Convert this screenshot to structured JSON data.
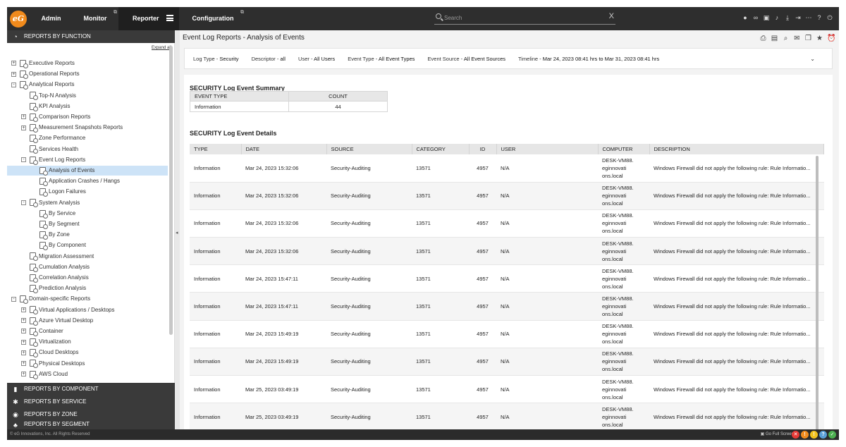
{
  "topbar": {
    "logo": "eG",
    "tabs": [
      {
        "label": "Admin"
      },
      {
        "label": "Monitor"
      },
      {
        "label": "Reporter"
      },
      {
        "label": "Configuration"
      }
    ],
    "search_placeholder": "Search",
    "clear": "X",
    "icons": [
      "user-icon",
      "link-icon",
      "image-icon",
      "bell-icon",
      "download-icon",
      "logout-icon",
      "more-icon",
      "help-icon",
      "power-icon"
    ]
  },
  "sidebar": {
    "sections": {
      "function": "REPORTS BY FUNCTION",
      "component": "REPORTS BY COMPONENT",
      "service": "REPORTS BY SERVICE",
      "zone": "REPORTS BY ZONE",
      "segment": "REPORTS BY SEGMENT"
    },
    "expand_all": "Expand all",
    "tree": [
      {
        "label": "Executive Reports",
        "level": 0,
        "toggle": "+"
      },
      {
        "label": "Operational Reports",
        "level": 0,
        "toggle": "+"
      },
      {
        "label": "Analytical Reports",
        "level": 0,
        "toggle": "-"
      },
      {
        "label": "Top-N Analysis",
        "level": 1,
        "toggle": ""
      },
      {
        "label": "KPI Analysis",
        "level": 1,
        "toggle": ""
      },
      {
        "label": "Comparison Reports",
        "level": 1,
        "toggle": "+"
      },
      {
        "label": "Measurement Snapshots Reports",
        "level": 1,
        "toggle": "+"
      },
      {
        "label": "Zone Performance",
        "level": 1,
        "toggle": ""
      },
      {
        "label": "Services Health",
        "level": 1,
        "toggle": ""
      },
      {
        "label": "Event Log Reports",
        "level": 1,
        "toggle": "-"
      },
      {
        "label": "Analysis of Events",
        "level": 2,
        "toggle": "",
        "selected": true
      },
      {
        "label": "Application Crashes / Hangs",
        "level": 2,
        "toggle": ""
      },
      {
        "label": "Logon Failures",
        "level": 2,
        "toggle": ""
      },
      {
        "label": "System Analysis",
        "level": 1,
        "toggle": "-"
      },
      {
        "label": "By Service",
        "level": 2,
        "toggle": ""
      },
      {
        "label": "By Segment",
        "level": 2,
        "toggle": ""
      },
      {
        "label": "By Zone",
        "level": 2,
        "toggle": ""
      },
      {
        "label": "By Component",
        "level": 2,
        "toggle": ""
      },
      {
        "label": "Migration Assessment",
        "level": 1,
        "toggle": ""
      },
      {
        "label": "Cumulation Analysis",
        "level": 1,
        "toggle": ""
      },
      {
        "label": "Correlation Analysis",
        "level": 1,
        "toggle": ""
      },
      {
        "label": "Prediction Analysis",
        "level": 1,
        "toggle": ""
      },
      {
        "label": "Domain-specific Reports",
        "level": 0,
        "toggle": "-"
      },
      {
        "label": "Virtual Applications / Desktops",
        "level": 1,
        "toggle": "+"
      },
      {
        "label": "Azure Virtual Desktop",
        "level": 1,
        "toggle": "+"
      },
      {
        "label": "Container",
        "level": 1,
        "toggle": "+"
      },
      {
        "label": "Virtualization",
        "level": 1,
        "toggle": "+"
      },
      {
        "label": "Cloud Desktops",
        "level": 1,
        "toggle": "+"
      },
      {
        "label": "Physical Desktops",
        "level": 1,
        "toggle": "+"
      },
      {
        "label": "AWS Cloud",
        "level": 1,
        "toggle": "+"
      }
    ]
  },
  "main": {
    "title": "Event Log Reports - Analysis of Events",
    "filters": [
      {
        "key": "Log Type - ",
        "value": "Security"
      },
      {
        "key": "Descriptor - ",
        "value": "all"
      },
      {
        "key": "User - ",
        "value": "All Users"
      },
      {
        "key": "Event Type - ",
        "value": "All Event Types"
      },
      {
        "key": "Event Source - ",
        "value": "All Event Sources"
      },
      {
        "key": "Timeline - ",
        "value": "Mar 24, 2023 08:41 hrs to Mar 31, 2023 08:41 hrs"
      }
    ],
    "summary_title": "SECURITY Log Event Summary",
    "summary_headers": [
      "EVENT TYPE",
      "COUNT"
    ],
    "summary_rows": [
      [
        "Information",
        "44"
      ]
    ],
    "details_title": "SECURITY Log Event Details",
    "details_headers": [
      "TYPE",
      "DATE",
      "SOURCE",
      "CATEGORY",
      "ID",
      "USER",
      "COMPUTER",
      "DESCRIPTION"
    ],
    "details_rows": [
      [
        "Information",
        "Mar 24, 2023 15:32:06",
        "Security-Auditing",
        "13571",
        "4957",
        "N/A",
        "DESK-VM88.|eginnovati|ons.local",
        "Windows Firewall did not apply the following rule: Rule Informatio..."
      ],
      [
        "Information",
        "Mar 24, 2023 15:32:06",
        "Security-Auditing",
        "13571",
        "4957",
        "N/A",
        "DESK-VM88.|eginnovati|ons.local",
        "Windows Firewall did not apply the following rule: Rule Informatio..."
      ],
      [
        "Information",
        "Mar 24, 2023 15:32:06",
        "Security-Auditing",
        "13571",
        "4957",
        "N/A",
        "DESK-VM88.|eginnovati|ons.local",
        "Windows Firewall did not apply the following rule: Rule Informatio..."
      ],
      [
        "Information",
        "Mar 24, 2023 15:32:06",
        "Security-Auditing",
        "13571",
        "4957",
        "N/A",
        "DESK-VM88.|eginnovati|ons.local",
        "Windows Firewall did not apply the following rule: Rule Informatio..."
      ],
      [
        "Information",
        "Mar 24, 2023 15:47:11",
        "Security-Auditing",
        "13571",
        "4957",
        "N/A",
        "DESK-VM88.|eginnovati|ons.local",
        "Windows Firewall did not apply the following rule: Rule Informatio..."
      ],
      [
        "Information",
        "Mar 24, 2023 15:47:11",
        "Security-Auditing",
        "13571",
        "4957",
        "N/A",
        "DESK-VM88.|eginnovati|ons.local",
        "Windows Firewall did not apply the following rule: Rule Informatio..."
      ],
      [
        "Information",
        "Mar 24, 2023 15:49:19",
        "Security-Auditing",
        "13571",
        "4957",
        "N/A",
        "DESK-VM88.|eginnovati|ons.local",
        "Windows Firewall did not apply the following rule: Rule Informatio..."
      ],
      [
        "Information",
        "Mar 24, 2023 15:49:19",
        "Security-Auditing",
        "13571",
        "4957",
        "N/A",
        "DESK-VM88.|eginnovati|ons.local",
        "Windows Firewall did not apply the following rule: Rule Informatio..."
      ],
      [
        "Information",
        "Mar 25, 2023 03:49:19",
        "Security-Auditing",
        "13571",
        "4957",
        "N/A",
        "DESK-VM88.|eginnovati|ons.local",
        "Windows Firewall did not apply the following rule: Rule Informatio..."
      ],
      [
        "Information",
        "Mar 25, 2023 03:49:19",
        "Security-Auditing",
        "13571",
        "4957",
        "N/A",
        "DESK-VM88.|eginnovati|ons.local",
        "Windows Firewall did not apply the following rule: Rule Informatio..."
      ]
    ],
    "page_icons": [
      "export-pdf-icon",
      "export-excel-icon",
      "preview-icon",
      "mail-icon",
      "copy-icon",
      "favorite-icon",
      "schedule-icon"
    ]
  },
  "footer": {
    "copyright": "© eG Innovations, Inc. All Rights Reserved",
    "fullscreen": "Go Full Screen",
    "status": [
      {
        "name": "critical",
        "color": "#e53935",
        "glyph": "✕"
      },
      {
        "name": "major",
        "color": "#f28c1e",
        "glyph": "!"
      },
      {
        "name": "minor",
        "color": "#f2c21e",
        "glyph": "!"
      },
      {
        "name": "unknown",
        "color": "#5aa0d8",
        "glyph": "?"
      },
      {
        "name": "normal",
        "color": "#4caf50",
        "glyph": "✓"
      }
    ]
  },
  "colors": {
    "accent": "#f08a1c",
    "topbar": "#2e2e2e",
    "selected": "#cde3f7"
  }
}
